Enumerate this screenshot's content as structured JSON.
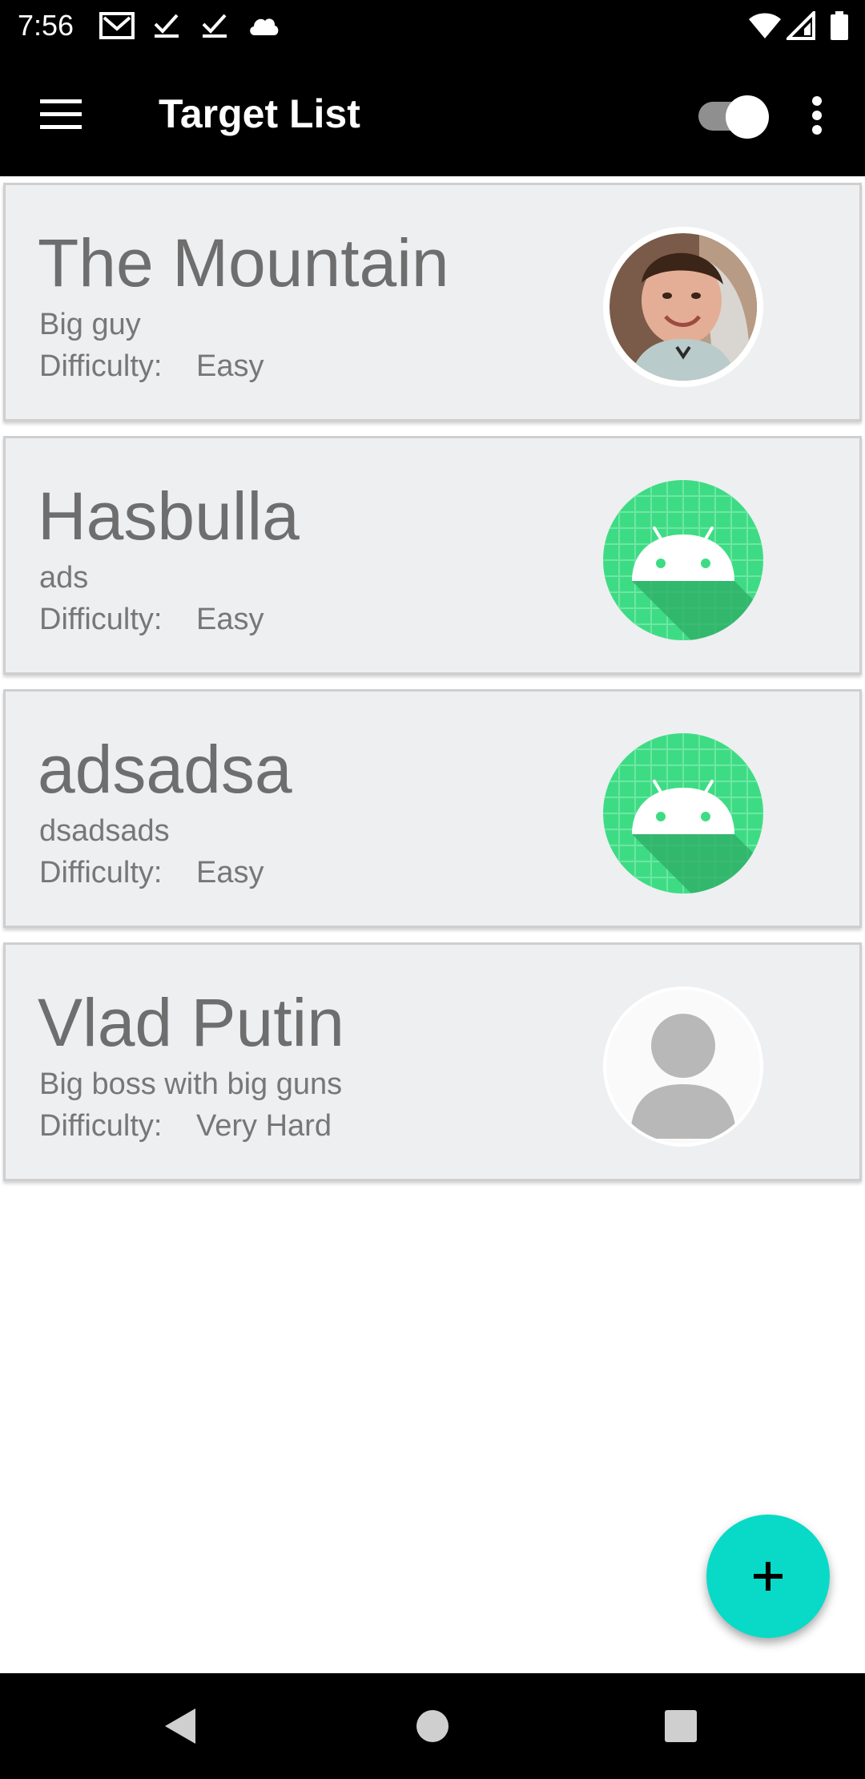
{
  "status_bar": {
    "time": "7:56",
    "left_icons": [
      "gmail-icon",
      "checkmark-icon",
      "checkmark-icon",
      "cloud-icon"
    ],
    "right_icons": [
      "wifi-icon",
      "cell-signal-icon",
      "battery-icon"
    ]
  },
  "app_bar": {
    "title": "Target List",
    "menu_icon": "hamburger-menu-icon",
    "toggle_on": true,
    "overflow_icon": "more-vert-icon"
  },
  "targets": [
    {
      "name": "The Mountain",
      "description": "Big guy",
      "difficulty_label": "Difficulty:",
      "difficulty": "Easy",
      "avatar": "photo-avatar"
    },
    {
      "name": "Hasbulla",
      "description": "ads",
      "difficulty_label": "Difficulty:",
      "difficulty": "Easy",
      "avatar": "android-avatar"
    },
    {
      "name": "adsadsa",
      "description": "dsadsads",
      "difficulty_label": "Difficulty:",
      "difficulty": "Easy",
      "avatar": "android-avatar"
    },
    {
      "name": "Vlad Putin",
      "description": "Big boss with big guns",
      "difficulty_label": "Difficulty:",
      "difficulty": "Very Hard",
      "avatar": "placeholder-person-avatar"
    }
  ],
  "fab": {
    "icon": "plus-icon",
    "color": "#08dac7"
  },
  "nav_bar": {
    "icons": [
      "back-icon",
      "home-icon",
      "recents-icon"
    ]
  },
  "colors": {
    "app_bar": "#000000",
    "card_background": "#eeeff1",
    "card_text": "#6e6e6e",
    "android_avatar": "#3ddc84"
  }
}
